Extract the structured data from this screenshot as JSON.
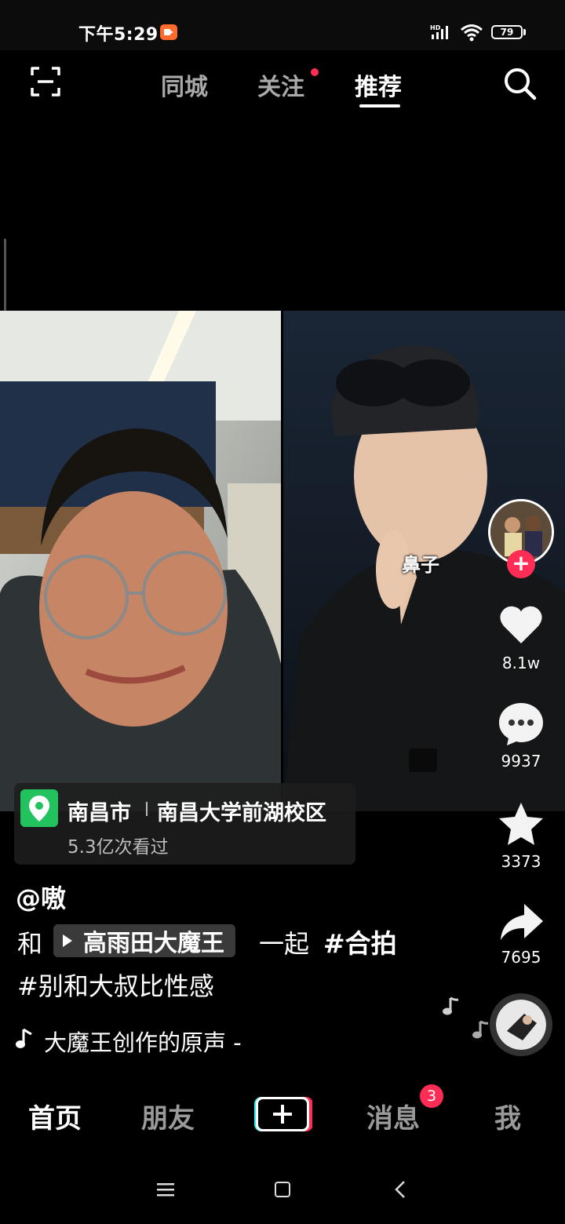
{
  "status_bar": {
    "time": "下午5:29",
    "battery": "79",
    "network": "HD"
  },
  "top_nav": {
    "tabs": [
      {
        "label": "同城",
        "active": false
      },
      {
        "label": "关注",
        "active": false,
        "has_dot": true
      },
      {
        "label": "推荐",
        "active": true
      }
    ]
  },
  "video": {
    "caption_overlay": "鼻子"
  },
  "actions": {
    "like_count": "8.1w",
    "comment_count": "9937",
    "favorite_count": "3373",
    "share_count": "7695"
  },
  "location": {
    "city": "南昌市",
    "place": "南昌大学前湖校区",
    "views": "5.3亿次看过"
  },
  "post": {
    "username": "@嗷",
    "desc_and": "和",
    "mention": "高雨田大魔王",
    "desc_together": "一起",
    "hashtag_1": "#合拍",
    "hashtag_2": "#别和大叔比性感",
    "music": "大魔王创作的原声 -"
  },
  "bottom_nav": {
    "items": [
      {
        "label": "首页",
        "active": true
      },
      {
        "label": "朋友",
        "active": false
      },
      {
        "label": "消息",
        "active": false,
        "badge": "3"
      },
      {
        "label": "我",
        "active": false
      }
    ]
  },
  "colors": {
    "accent_red": "#ff2c55",
    "location_green": "#22c35e"
  }
}
